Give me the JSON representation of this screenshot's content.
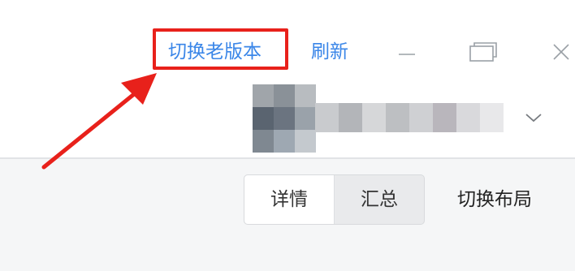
{
  "titlebar": {
    "switch_old_version": "切换老版本",
    "refresh": "刷新",
    "link_color": "#3a86e8",
    "window_controls": {
      "minimize_icon": "minimize-icon",
      "maximize_icon": "restore-icon",
      "close_icon": "close-icon"
    }
  },
  "annotation": {
    "highlight_color": "#e8211b",
    "arrow_color": "#e8211b"
  },
  "account": {
    "avatar": "blurred-avatar",
    "username": "",
    "dropdown_icon": "chevron-down-icon"
  },
  "view_tabs": {
    "items": [
      {
        "label": "详情",
        "selected": true
      },
      {
        "label": "汇总",
        "selected": false
      }
    ]
  },
  "toolbar": {
    "switch_layout": "切换布局"
  }
}
